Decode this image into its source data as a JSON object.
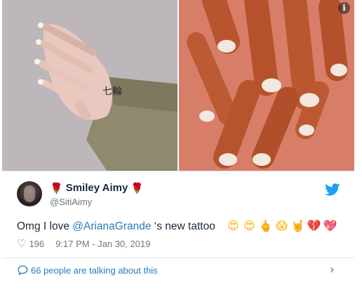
{
  "tweet": {
    "display_name": "Smiley Aimy",
    "handle": "@SitiAimy",
    "text_before": "Omg I love ",
    "mention": "@ArianaGrande",
    "text_after": " ‘s new tattoo",
    "emojis": [
      {
        "icon": "heart-eyes-emoji",
        "glyph": "😍"
      },
      {
        "icon": "heart-eyes-emoji",
        "glyph": "😍"
      },
      {
        "icon": "middle-finger-emoji",
        "glyph": "🖕"
      },
      {
        "icon": "screaming-face-emoji",
        "glyph": "😱"
      },
      {
        "icon": "rock-hand-emoji",
        "glyph": "🤘"
      },
      {
        "icon": "broken-heart-emoji",
        "glyph": "💔"
      },
      {
        "icon": "sparkling-heart-emoji",
        "glyph": "💖"
      }
    ],
    "likes": "196",
    "timestamp": "9:17 PM - Jan 30, 2019"
  },
  "footer": {
    "talking_label": "66 people are talking about this"
  },
  "media": {
    "left_alt_tattoo": "七輪",
    "info_glyph": "i"
  },
  "colors": {
    "link": "#2b7bb9",
    "twitter_blue": "#1da1f2",
    "muted": "#697882",
    "rose": "#c0142b"
  }
}
